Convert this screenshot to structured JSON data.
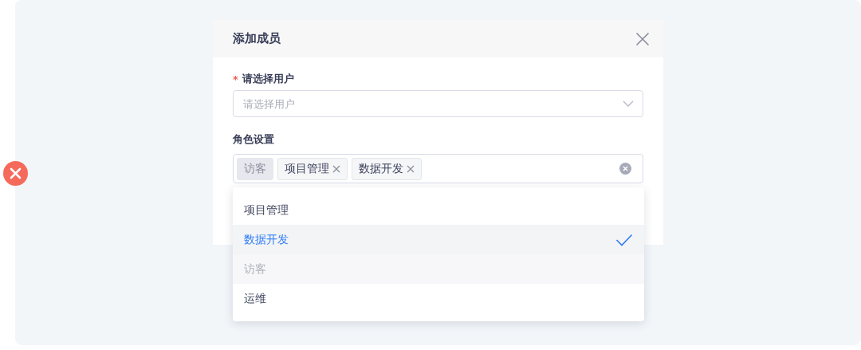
{
  "dialog": {
    "title": "添加成员",
    "user_field": {
      "required_mark": "*",
      "label": "请选择用户",
      "placeholder": "请选择用户"
    },
    "role_field": {
      "label": "角色设置",
      "tags": [
        {
          "label": "访客",
          "disabled": true
        },
        {
          "label": "项目管理",
          "disabled": false
        },
        {
          "label": "数据开发",
          "disabled": false
        }
      ],
      "options": [
        {
          "label": "项目管理",
          "selected": false,
          "disabled": false
        },
        {
          "label": "数据开发",
          "selected": true,
          "disabled": false
        },
        {
          "label": "访客",
          "selected": false,
          "disabled": true
        },
        {
          "label": "运维",
          "selected": false,
          "disabled": false
        }
      ]
    }
  }
}
